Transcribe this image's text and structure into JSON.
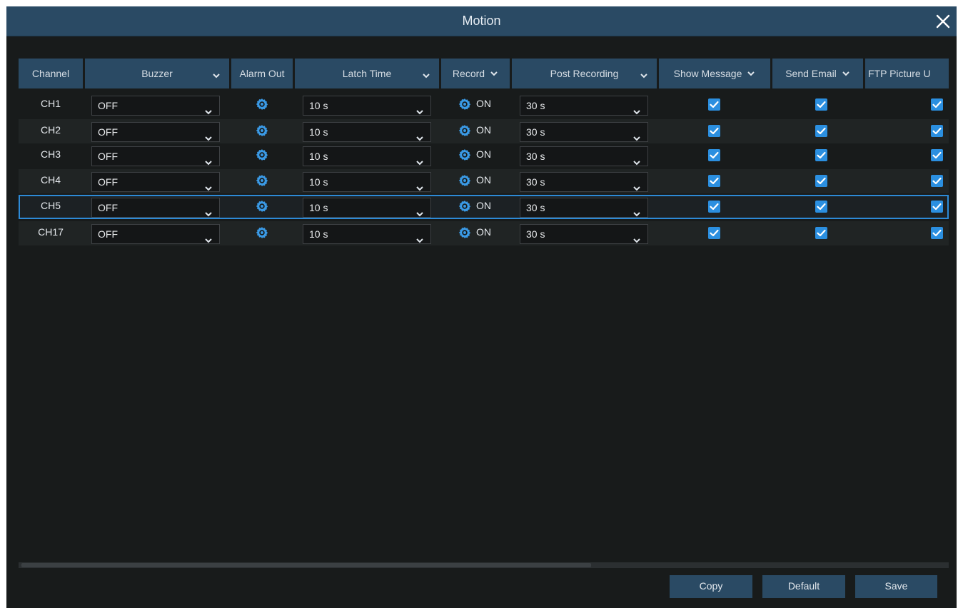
{
  "dialog": {
    "title": "Motion",
    "close_icon": "close-icon"
  },
  "columns": {
    "channel": "Channel",
    "buzzer": "Buzzer",
    "alarm_out": "Alarm Out",
    "latch_time": "Latch Time",
    "record": "Record",
    "post_recording": "Post Recording",
    "show_message": "Show Message",
    "send_email": "Send Email",
    "ftp_picture": "FTP Picture U"
  },
  "rows": [
    {
      "channel": "CH1",
      "buzzer": "OFF",
      "latch_time": "10 s",
      "record": "ON",
      "post_recording": "30 s",
      "show_message": true,
      "send_email": true,
      "ftp_picture": true
    },
    {
      "channel": "CH2",
      "buzzer": "OFF",
      "latch_time": "10 s",
      "record": "ON",
      "post_recording": "30 s",
      "show_message": true,
      "send_email": true,
      "ftp_picture": true
    },
    {
      "channel": "CH3",
      "buzzer": "OFF",
      "latch_time": "10 s",
      "record": "ON",
      "post_recording": "30 s",
      "show_message": true,
      "send_email": true,
      "ftp_picture": true
    },
    {
      "channel": "CH4",
      "buzzer": "OFF",
      "latch_time": "10 s",
      "record": "ON",
      "post_recording": "30 s",
      "show_message": true,
      "send_email": true,
      "ftp_picture": true
    },
    {
      "channel": "CH5",
      "buzzer": "OFF",
      "latch_time": "10 s",
      "record": "ON",
      "post_recording": "30 s",
      "show_message": true,
      "send_email": true,
      "ftp_picture": true
    },
    {
      "channel": "CH17",
      "buzzer": "OFF",
      "latch_time": "10 s",
      "record": "ON",
      "post_recording": "30 s",
      "show_message": true,
      "send_email": true,
      "ftp_picture": true
    }
  ],
  "selected_row": "CH5",
  "buttons": {
    "copy": "Copy",
    "default": "Default",
    "save": "Save"
  },
  "icons": {
    "settings": "gear-icon",
    "dropdown": "chevron-down-icon",
    "checkbox": "checkbox-checked-icon"
  },
  "colors": {
    "accent": "#2b8fe0",
    "header": "#2a4a64",
    "background": "#181b1b",
    "selection": "#2d8ad6"
  }
}
